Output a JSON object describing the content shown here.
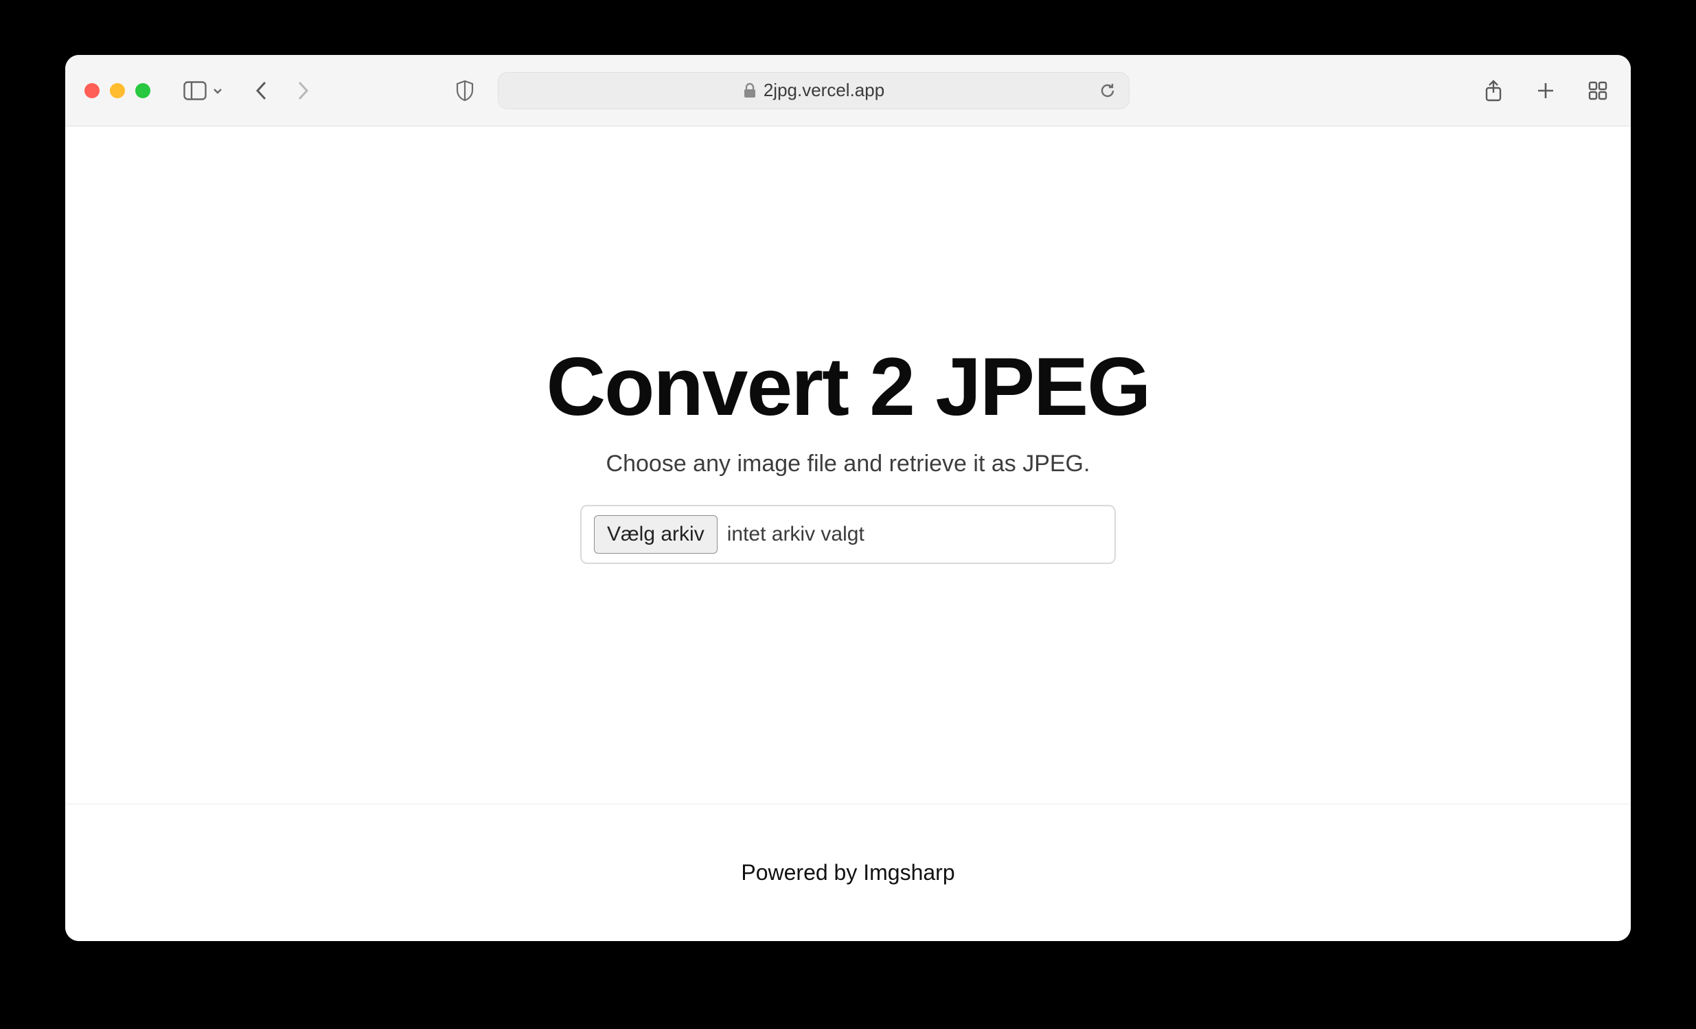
{
  "browser": {
    "url": "2jpg.vercel.app"
  },
  "page": {
    "title": "Convert 2 JPEG",
    "subtitle": "Choose any image file and retrieve it as JPEG.",
    "file_input": {
      "button_label": "Vælg arkiv",
      "status": "intet arkiv valgt"
    },
    "footer": "Powered by Imgsharp"
  }
}
